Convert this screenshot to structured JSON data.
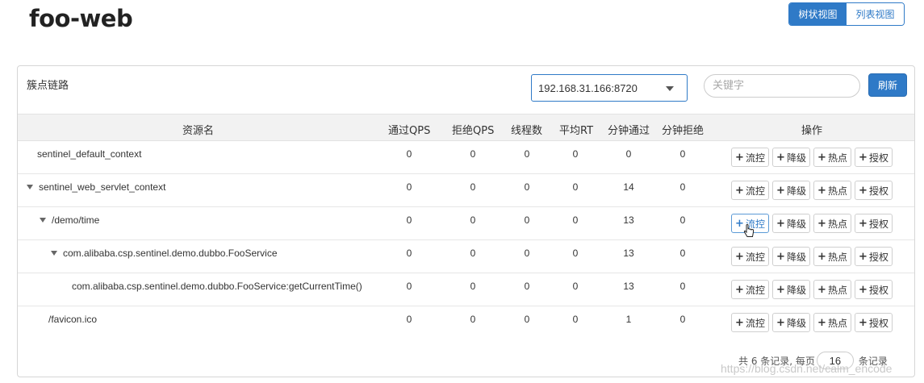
{
  "app": {
    "title": "foo-web"
  },
  "view_toggle": {
    "tree_label": "树状视图",
    "list_label": "列表视图",
    "active": "tree"
  },
  "panel": {
    "title": "簇点链路",
    "machine_select": {
      "value": "192.168.31.166:8720"
    },
    "search": {
      "placeholder": "关键字",
      "value": ""
    },
    "refresh_label": "刷新"
  },
  "table": {
    "columns": [
      "资源名",
      "通过QPS",
      "拒绝QPS",
      "线程数",
      "平均RT",
      "分钟通过",
      "分钟拒绝",
      "操作"
    ],
    "op_labels": {
      "flow": "流控",
      "degrade": "降级",
      "hot": "热点",
      "auth": "授权"
    },
    "rows": [
      {
        "name": "sentinel_default_context",
        "level": 0,
        "expandable": false,
        "pass_qps": "0",
        "block_qps": "0",
        "threads": "0",
        "avg_rt": "0",
        "min_pass": "0",
        "min_block": "0"
      },
      {
        "name": "sentinel_web_servlet_context",
        "level": 0,
        "expandable": true,
        "pass_qps": "0",
        "block_qps": "0",
        "threads": "0",
        "avg_rt": "0",
        "min_pass": "14",
        "min_block": "0"
      },
      {
        "name": "/demo/time",
        "level": 1,
        "expandable": true,
        "pass_qps": "0",
        "block_qps": "0",
        "threads": "0",
        "avg_rt": "0",
        "min_pass": "13",
        "min_block": "0"
      },
      {
        "name": "com.alibaba.csp.sentinel.demo.dubbo.FooService",
        "level": 2,
        "expandable": true,
        "pass_qps": "0",
        "block_qps": "0",
        "threads": "0",
        "avg_rt": "0",
        "min_pass": "13",
        "min_block": "0"
      },
      {
        "name": "com.alibaba.csp.sentinel.demo.dubbo.FooService:getCurrentTime()",
        "level": 3,
        "expandable": false,
        "pass_qps": "0",
        "block_qps": "0",
        "threads": "0",
        "avg_rt": "0",
        "min_pass": "13",
        "min_block": "0"
      },
      {
        "name": "/favicon.ico",
        "level": 1,
        "expandable": false,
        "pass_qps": "0",
        "block_qps": "0",
        "threads": "0",
        "avg_rt": "0",
        "min_pass": "1",
        "min_block": "0"
      }
    ]
  },
  "pagination": {
    "prefix": "共 6 条记录, 每页",
    "page_size": "16",
    "suffix": "条记录"
  },
  "watermark": "https://blog.csdn.net/calm_encode",
  "colors": {
    "accent": "#2f7ac7",
    "header_bg": "#f2f2f2",
    "border": "#d6d6d6"
  }
}
